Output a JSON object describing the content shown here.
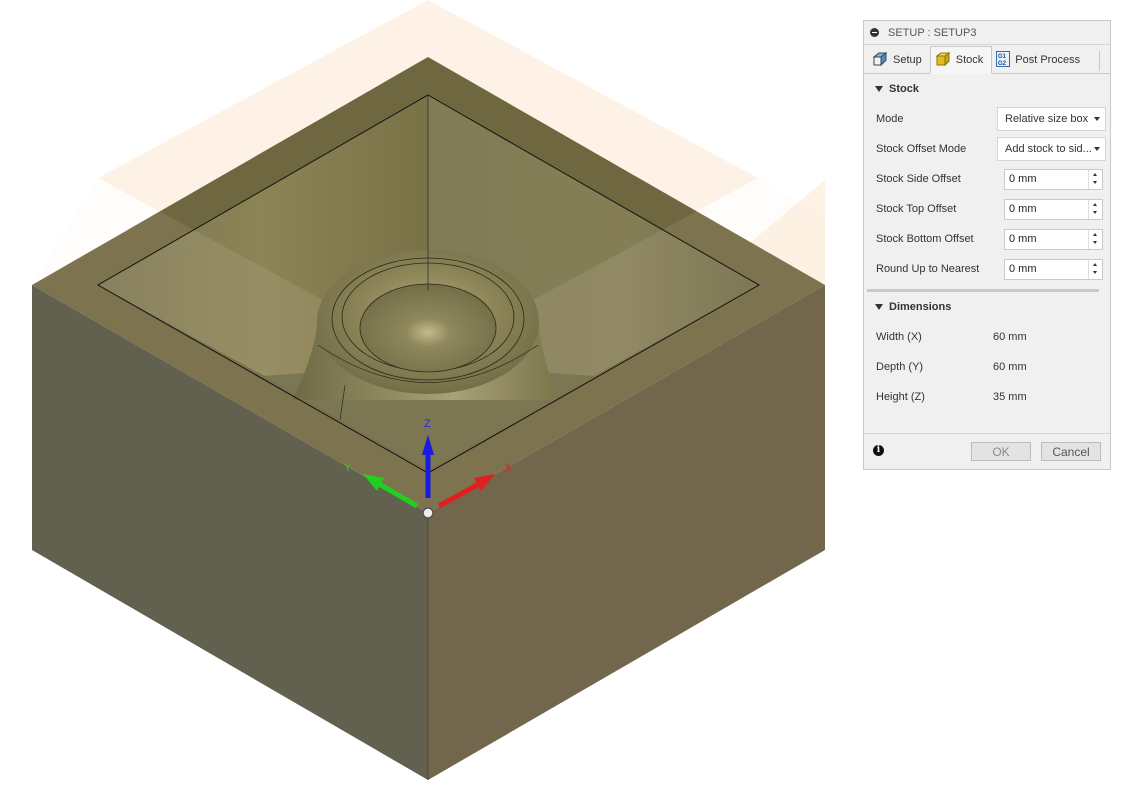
{
  "viewport": {
    "stock_plane_color": "#fdf0e0",
    "axes": {
      "x_label": "X",
      "y_label": "Y",
      "z_label": "Z",
      "x_color": "#e02020",
      "y_color": "#20d020",
      "z_color": "#1a1ae0"
    }
  },
  "panel": {
    "title": "SETUP : SETUP3",
    "tabs": [
      {
        "label": "Setup",
        "icon": "setup-cube-icon",
        "active": false
      },
      {
        "label": "Stock",
        "icon": "stock-cube-icon",
        "active": true
      },
      {
        "label": "Post Process",
        "icon": "g1-g2-icon",
        "active": false
      }
    ],
    "stock_section": {
      "title": "Stock",
      "mode": {
        "label": "Mode",
        "value": "Relative size box"
      },
      "offset_mode": {
        "label": "Stock Offset Mode",
        "value": "Add stock to sid..."
      },
      "fields": [
        {
          "label": "Stock Side Offset",
          "value": "0 mm"
        },
        {
          "label": "Stock Top Offset",
          "value": "0 mm"
        },
        {
          "label": "Stock Bottom Offset",
          "value": "0 mm"
        },
        {
          "label": "Round Up to Nearest",
          "value": "0 mm"
        }
      ]
    },
    "dimensions_section": {
      "title": "Dimensions",
      "rows": [
        {
          "label": "Width (X)",
          "value": "60 mm"
        },
        {
          "label": "Depth (Y)",
          "value": "60 mm"
        },
        {
          "label": "Height (Z)",
          "value": "35 mm"
        }
      ]
    },
    "footer": {
      "info_icon": "info-icon",
      "ok_label": "OK",
      "cancel_label": "Cancel"
    }
  }
}
